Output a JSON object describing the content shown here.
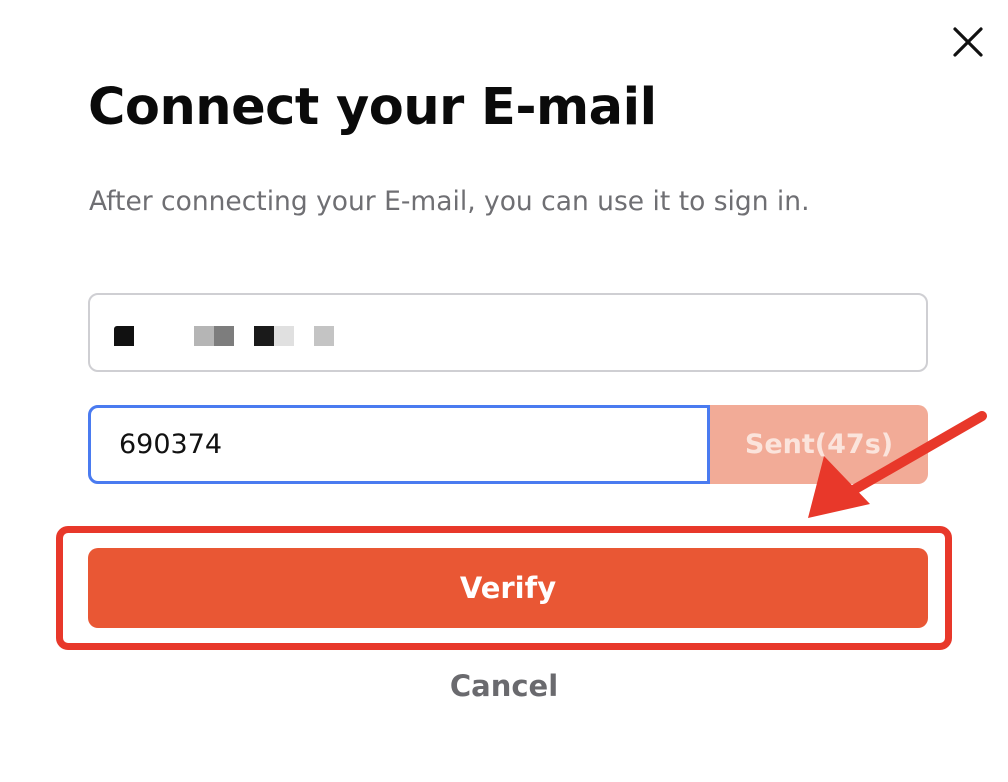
{
  "dialog": {
    "title": "Connect your E-mail",
    "subtitle": "After connecting your E-mail, you can use it to sign in."
  },
  "email_field": {
    "value_redacted": true,
    "icon": "redacted-pixel-blocks"
  },
  "code_field": {
    "value": "690374"
  },
  "sent_button": {
    "label": "Sent(47s)"
  },
  "verify_button": {
    "label": "Verify"
  },
  "cancel_button": {
    "label": "Cancel"
  },
  "icons": {
    "close": "close-icon",
    "annotation_arrow": "arrow-icon"
  },
  "colors": {
    "accent": "#e95734",
    "sent_disabled": "#f2ab97",
    "focus_border": "#4a7bf0",
    "annotation": "#e8382a",
    "title": "#0a0a0a",
    "subtitle": "#6f6f73"
  }
}
